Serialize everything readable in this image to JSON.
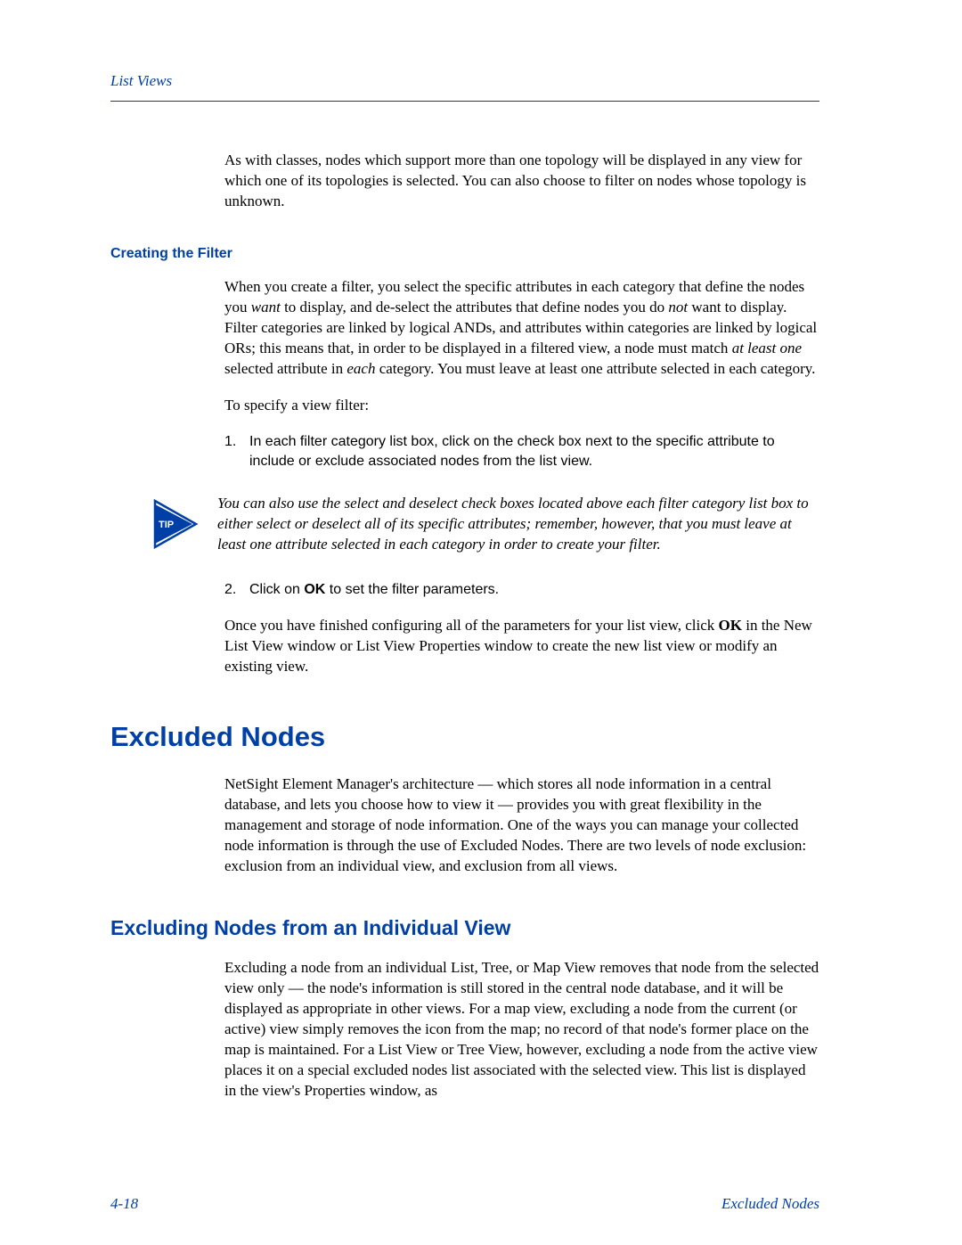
{
  "header": {
    "title": "List Views"
  },
  "footer": {
    "page": "4-18",
    "section": "Excluded Nodes"
  },
  "p_intro": "As with classes, nodes which support more than one topology will be displayed in any view for which one of its topologies is selected. You can also choose to filter on nodes whose topology is unknown.",
  "sub_creating": "Creating the Filter",
  "p_creating_1a": "When you create a filter, you select the specific attributes in each category that define the nodes you ",
  "p_creating_1_want": "want",
  "p_creating_1b": " to display, and de-select the attributes that define nodes you do ",
  "p_creating_1_not": "not",
  "p_creating_1c": " want to display. Filter categories are linked by logical ANDs, and attributes within categories are linked by logical ORs; this means that, in order to be displayed in a filtered view, a node must match ",
  "p_creating_1_alo": "at least one",
  "p_creating_1d": " selected attribute in ",
  "p_creating_1_each": "each",
  "p_creating_1e": " category. You must leave at least one attribute selected in each category.",
  "p_specify": "To specify a view filter:",
  "step1_num": "1.",
  "step1_text": "In each filter category list box, click on the check box next to the specific attribute to include or exclude associated nodes from the list view.",
  "tip_label": "TIP",
  "tip_text": "You can also use the select and deselect check boxes located above each filter category list box to either select or deselect all of its specific attributes; remember, however, that you must leave at least one attribute selected in each category in order to create your filter.",
  "step2_num": "2.",
  "step2_a": "Click on ",
  "step2_ok": "OK",
  "step2_b": " to set the filter parameters.",
  "p_finish_a": "Once you have finished configuring all of the parameters for your list view, click ",
  "p_finish_ok": "OK",
  "p_finish_b": " in the New List View window or List View Properties window to create the new list view or modify an existing view.",
  "h1_excluded": "Excluded Nodes",
  "p_excluded": "NetSight Element Manager's architecture — which stores all node information in a central database, and lets you choose how to view it — provides you with great flexibility in the management and storage of node information. One of the ways you can manage your collected node information is through the use of Excluded Nodes. There are two levels of node exclusion: exclusion from an individual view, and exclusion from all views.",
  "h2_excluding": "Excluding Nodes from an Individual View",
  "p_excluding": "Excluding a node from an individual List, Tree, or Map View removes that node from the selected view only — the node's information is still stored in the central node database, and it will be displayed as appropriate in other views. For a map view, excluding a node from the current (or active) view simply removes the icon from the map; no record of that node's former place on the map is maintained. For a List View or Tree View, however, excluding a node from the active view places it on a special excluded nodes list associated with the selected view. This list is displayed in the view's Properties window, as"
}
